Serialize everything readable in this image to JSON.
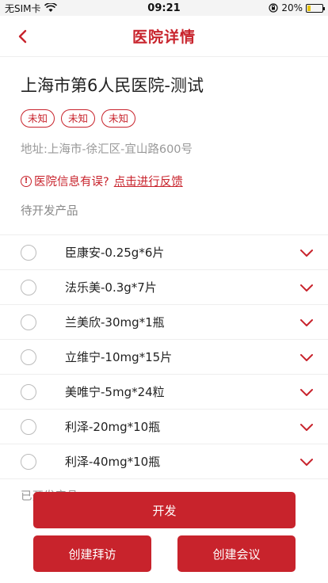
{
  "status_bar": {
    "carrier": "无SIM卡",
    "time": "09:21",
    "battery": "20%",
    "battery_level": 0.2,
    "icons": [
      "wifi-icon",
      "orientation-lock-icon",
      "battery-icon"
    ]
  },
  "nav": {
    "title": "医院详情",
    "back_icon": "chevron-left-icon"
  },
  "hospital": {
    "name": "上海市第6人民医院-测试",
    "tags": [
      "未知",
      "未知",
      "未知"
    ],
    "address": "地址:上海市-徐汇区-宜山路600号"
  },
  "feedback": {
    "icon_glyph": "!",
    "question": "医院信息有误?",
    "link": "点击进行反馈"
  },
  "sections": {
    "pending_label": "待开发产品",
    "developed_label": "已开发产品"
  },
  "products": [
    {
      "name": "臣康安-0.25g*6片"
    },
    {
      "name": "法乐美-0.3g*7片"
    },
    {
      "name": "兰美欣-30mg*1瓶"
    },
    {
      "name": "立维宁-10mg*15片"
    },
    {
      "name": "美唯宁-5mg*24粒"
    },
    {
      "name": "利泽-20mg*10瓶"
    },
    {
      "name": "利泽-40mg*10瓶"
    }
  ],
  "buttons": {
    "develop": "开发",
    "create_visit": "创建拜访",
    "create_meeting": "创建会议"
  },
  "colors": {
    "accent": "#c8232c",
    "text_muted": "#999999"
  }
}
